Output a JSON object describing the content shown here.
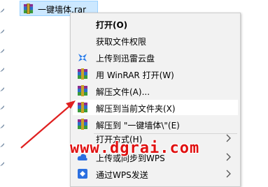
{
  "explorer": {
    "selected_file": "一键墙体.rar",
    "colors": {
      "selection_bg": "#cce8ff",
      "selection_border": "#99d1ff"
    }
  },
  "context_menu": {
    "items": [
      {
        "label": "打开(O)",
        "icon": "none",
        "bold": true
      },
      {
        "label": "获取文件权限",
        "icon": "none"
      },
      {
        "label": "上传到迅雷云盘",
        "icon": "xunlei-bird-icon"
      },
      {
        "label": "用 WinRAR 打开(W)",
        "icon": "winrar-icon"
      },
      {
        "label": "解压文件(A)...",
        "icon": "winrar-icon"
      },
      {
        "label": "解压到当前文件夹(X)",
        "icon": "winrar-icon",
        "highlighted": true
      },
      {
        "label": "解压到 \"一键墙体\\\"(E)",
        "icon": "winrar-icon"
      },
      {
        "label": "打开方式(H)",
        "icon": "none",
        "submenu": true
      },
      {
        "label": "上传或同步到WPS",
        "icon": "wps-cloud-icon",
        "submenu": true
      },
      {
        "label": "通过WPS发送",
        "icon": "wps-send-icon",
        "submenu": true
      }
    ]
  },
  "watermark": "www.dgrai.com",
  "accent_red": "#e01010"
}
